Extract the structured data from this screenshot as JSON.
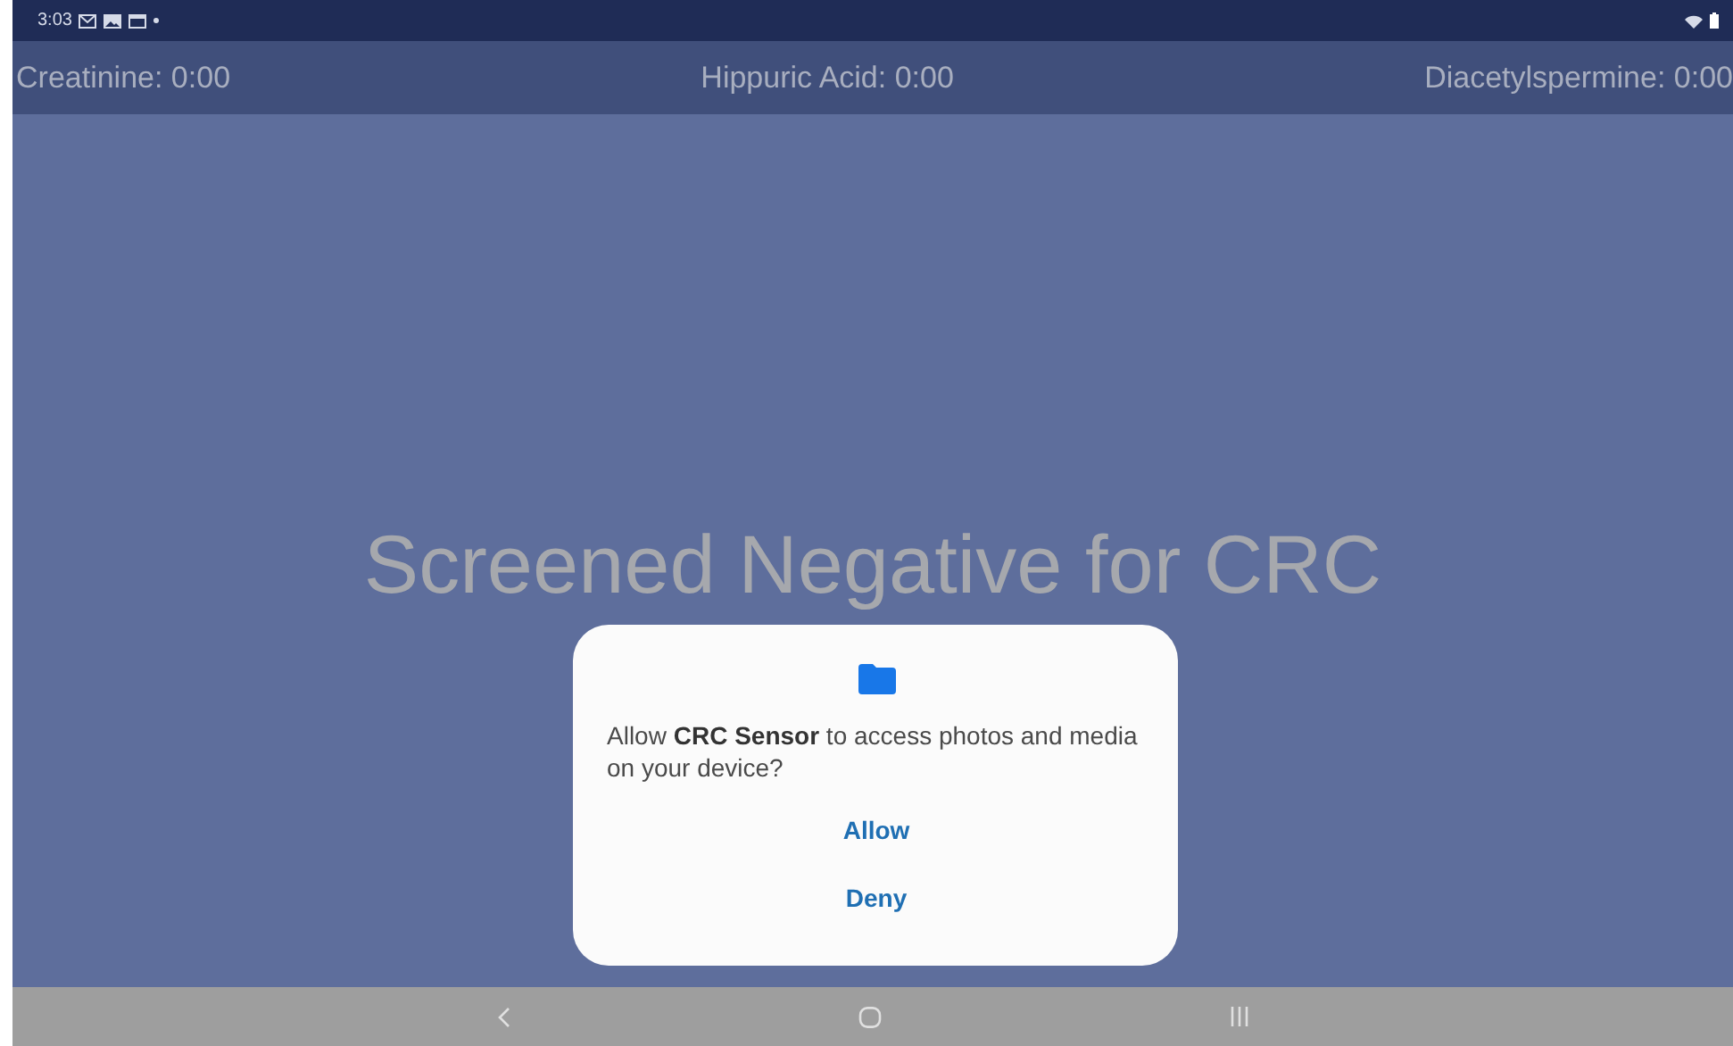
{
  "status_bar": {
    "time": "3:03"
  },
  "readings": [
    "Creatinine: 0:00",
    "Hippuric Acid: 0:00",
    "Diacetylspermine: 0:00"
  ],
  "result": "Screened Negative for CRC",
  "dialog": {
    "message": "Allow **CRC Sensor** to access photos and media on your device?",
    "buttons": [
      "Allow",
      "Deny"
    ]
  }
}
